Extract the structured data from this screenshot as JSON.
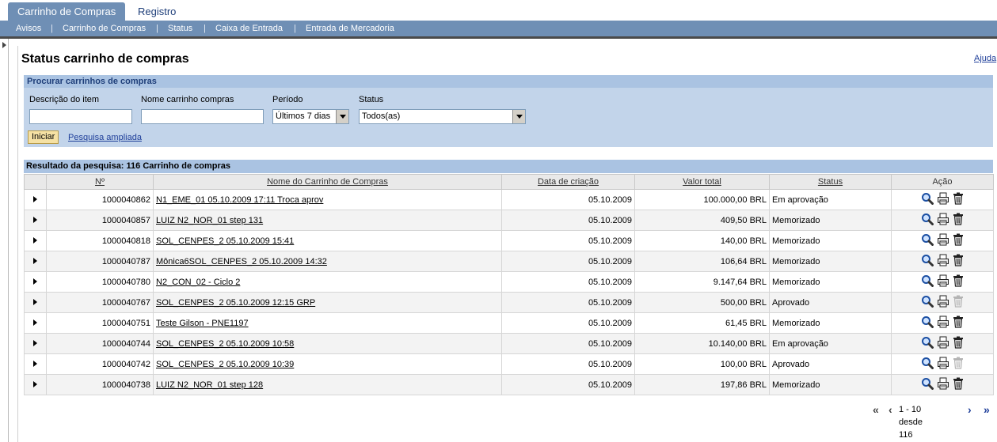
{
  "top_tabs": [
    {
      "label": "Carrinho de Compras",
      "active": true
    },
    {
      "label": "Registro",
      "active": false
    }
  ],
  "sub_nav": {
    "items": [
      "Avisos",
      "Carrinho de Compras",
      "Status",
      "Caixa de Entrada",
      "Entrada de Mercadoria"
    ],
    "separator": "|"
  },
  "page": {
    "title": "Status carrinho de compras",
    "help_label": "Ajuda"
  },
  "search": {
    "title": "Procurar carrinhos de compras",
    "description_label": "Descrição do item",
    "description_value": "",
    "cart_name_label": "Nome carrinho compras",
    "cart_name_value": "",
    "period_label": "Período",
    "period_value": "Últimos 7 dias",
    "status_label": "Status",
    "status_value": "Todos(as)",
    "start_button": "Iniciar",
    "advanced_link": "Pesquisa ampliada"
  },
  "results": {
    "title": "Resultado da pesquisa:  116 Carrinho de compras",
    "columns": [
      "Nº",
      "Nome do Carrinho de Compras",
      "Data de criação",
      "Valor total",
      "Status",
      "Ação"
    ],
    "rows": [
      {
        "num": "1000040862",
        "name": "N1_EME_01 05.10.2009 17:11 Troca aprov",
        "date": "05.10.2009",
        "total": "100.000,00 BRL",
        "status": "Em aprovação",
        "delete_enabled": true
      },
      {
        "num": "1000040857",
        "name": "LUIZ N2_NOR_01 step 131",
        "date": "05.10.2009",
        "total": "409,50 BRL",
        "status": "Memorizado",
        "delete_enabled": true
      },
      {
        "num": "1000040818",
        "name": "SOL_CENPES_2 05.10.2009 15:41",
        "date": "05.10.2009",
        "total": "140,00 BRL",
        "status": "Memorizado",
        "delete_enabled": true
      },
      {
        "num": "1000040787",
        "name": "Mônica6SOL_CENPES_2 05.10.2009 14:32",
        "date": "05.10.2009",
        "total": "106,64 BRL",
        "status": "Memorizado",
        "delete_enabled": true
      },
      {
        "num": "1000040780",
        "name": "N2_CON_02 - Ciclo 2",
        "date": "05.10.2009",
        "total": "9.147,64 BRL",
        "status": "Memorizado",
        "delete_enabled": true
      },
      {
        "num": "1000040767",
        "name": "SOL_CENPES_2 05.10.2009 12:15 GRP",
        "date": "05.10.2009",
        "total": "500,00 BRL",
        "status": "Aprovado",
        "delete_enabled": false
      },
      {
        "num": "1000040751",
        "name": "Teste Gilson - PNE1197",
        "date": "05.10.2009",
        "total": "61,45 BRL",
        "status": "Memorizado",
        "delete_enabled": true
      },
      {
        "num": "1000040744",
        "name": "SOL_CENPES_2 05.10.2009 10:58",
        "date": "05.10.2009",
        "total": "10.140,00 BRL",
        "status": "Em aprovação",
        "delete_enabled": true
      },
      {
        "num": "1000040742",
        "name": "SOL_CENPES_2 05.10.2009 10:39",
        "date": "05.10.2009",
        "total": "100,00 BRL",
        "status": "Aprovado",
        "delete_enabled": false
      },
      {
        "num": "1000040738",
        "name": "LUIZ N2_NOR_01 step 128",
        "date": "05.10.2009",
        "total": "197,86 BRL",
        "status": "Memorizado",
        "delete_enabled": true
      }
    ]
  },
  "pagination": {
    "first": "«",
    "prev": "‹",
    "range_text": "1 - 10 desde 116",
    "next": "›",
    "last": "»"
  },
  "icons": {
    "expand": "triangle-right-icon",
    "view": "magnifier-icon",
    "print": "printer-icon",
    "delete": "trash-icon"
  },
  "colors": {
    "nav_blue": "#6f8fb5",
    "panel_blue": "#c2d4ea",
    "header_blue": "#aac3e2",
    "link_blue": "#1f3f9a"
  }
}
